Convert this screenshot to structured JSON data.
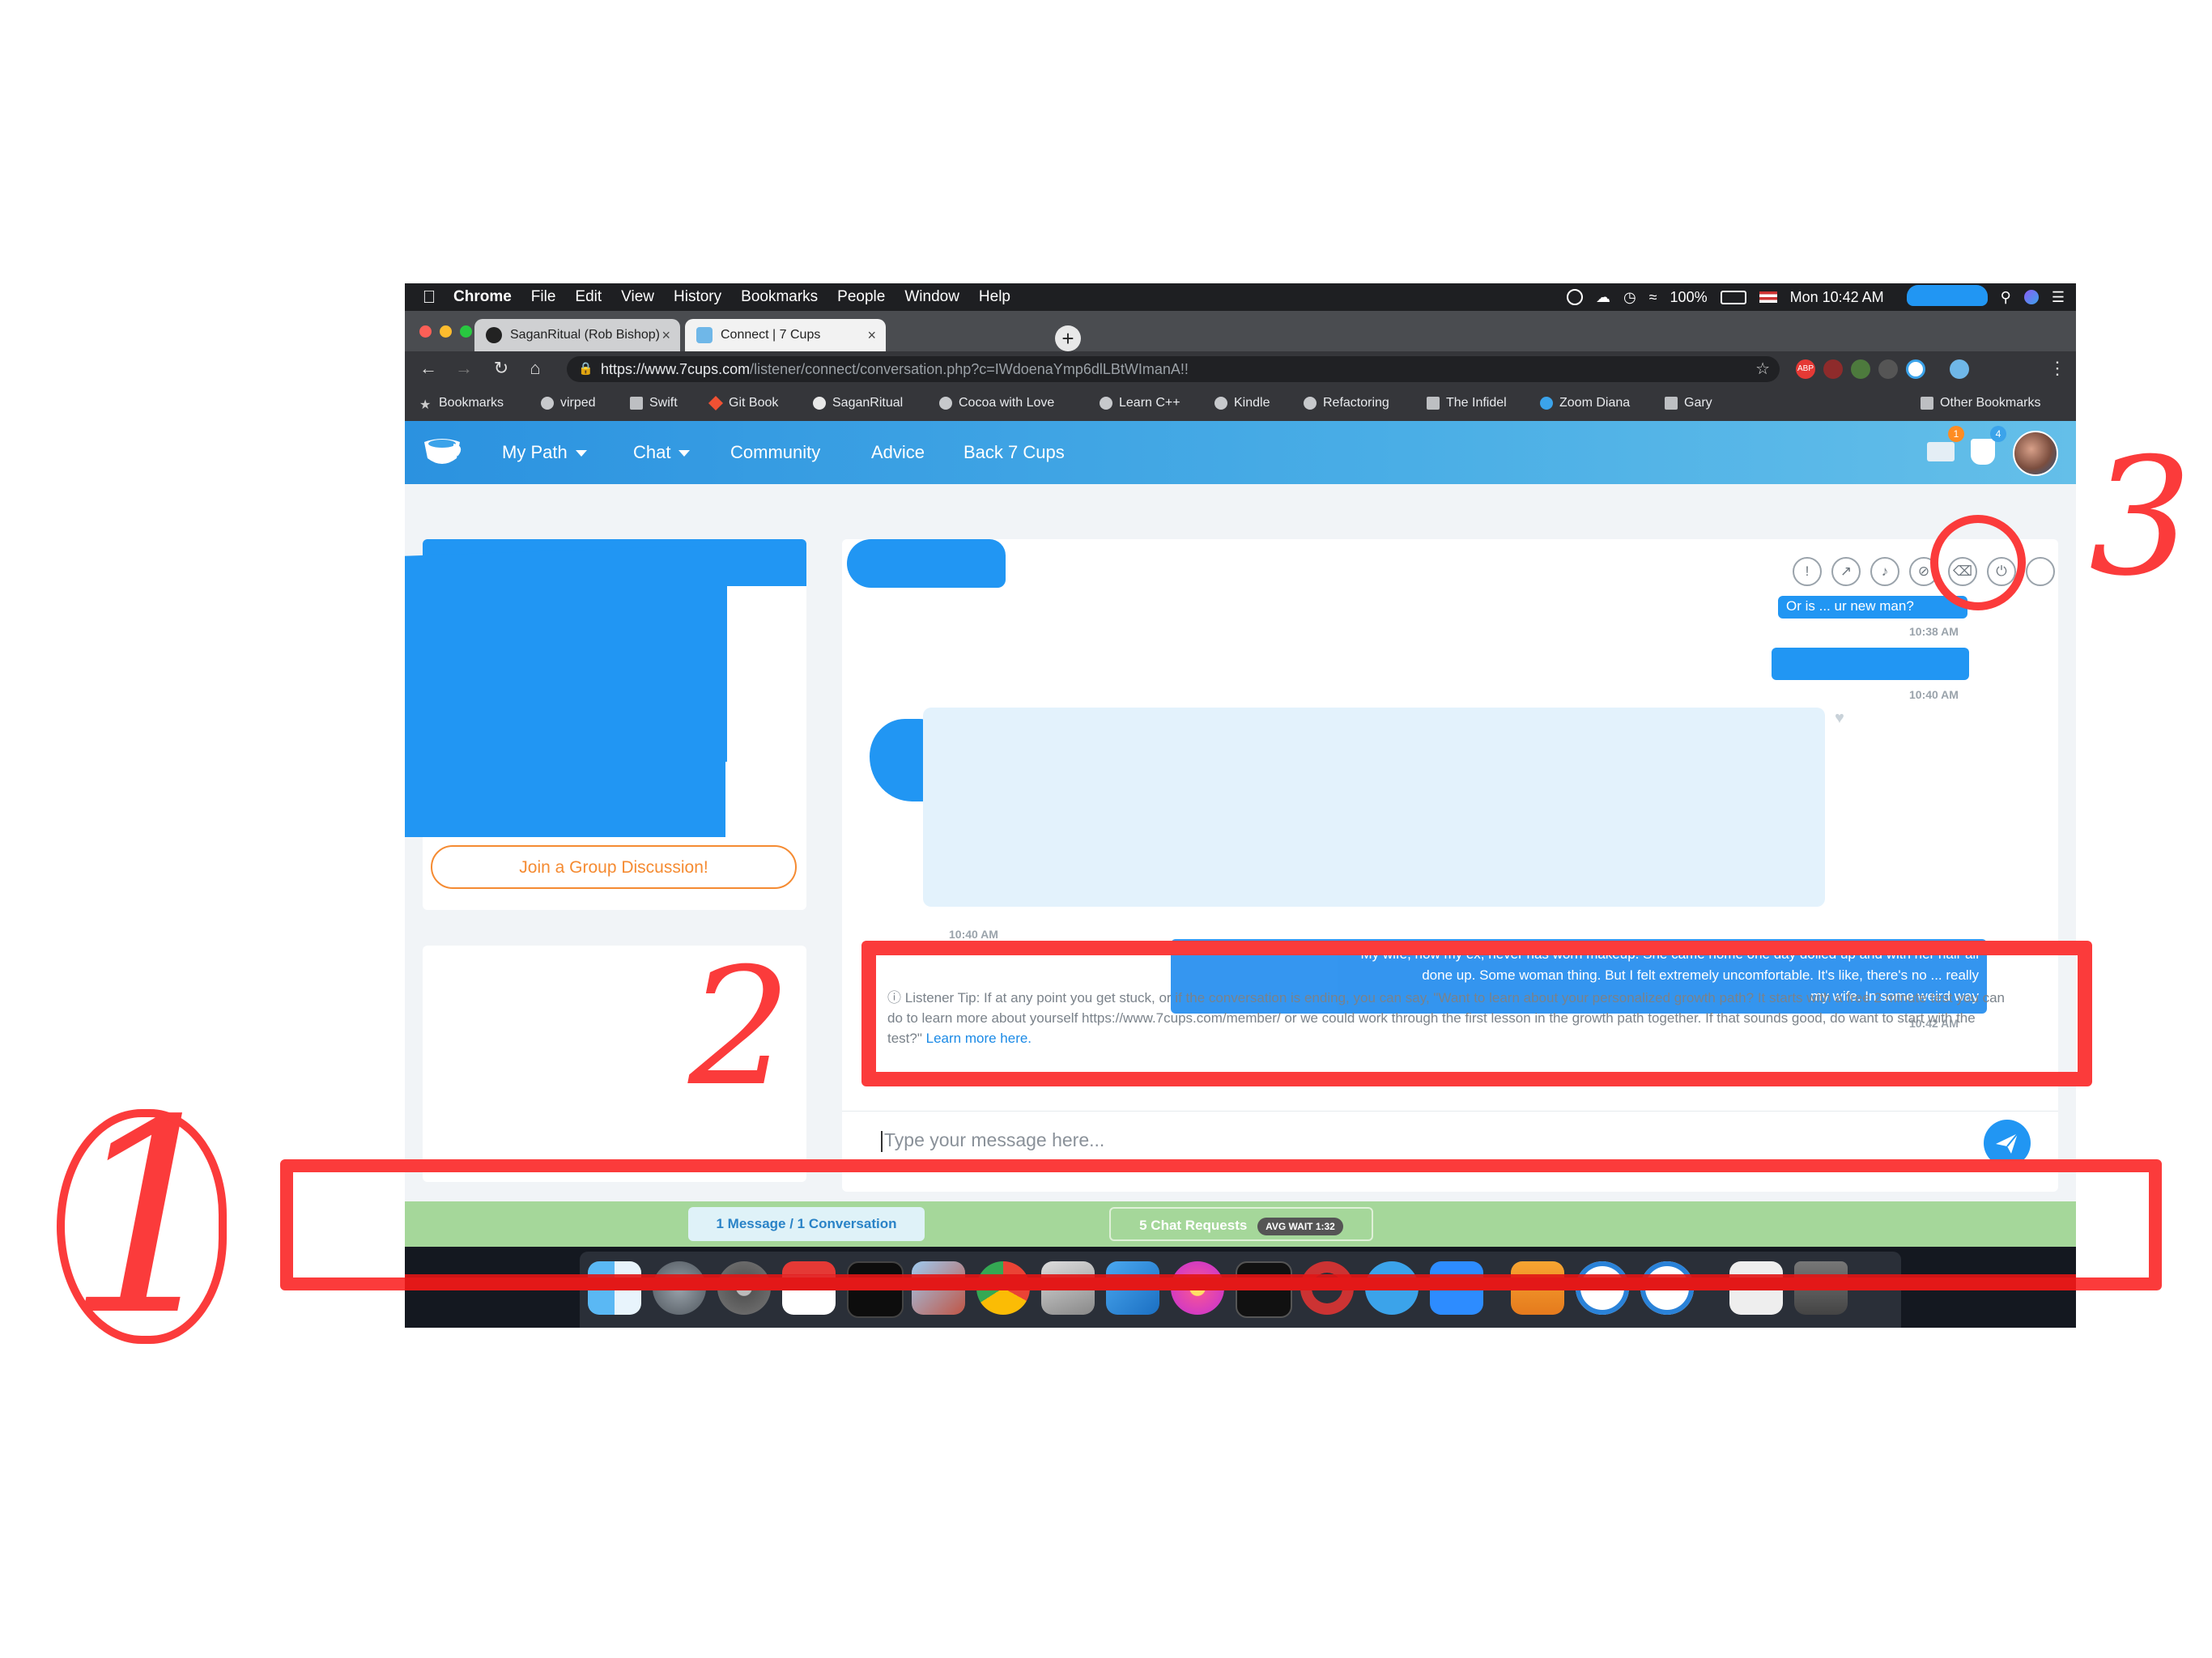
{
  "menubar": {
    "app": "Chrome",
    "items": [
      "File",
      "Edit",
      "View",
      "History",
      "Bookmarks",
      "People",
      "Window",
      "Help"
    ],
    "battery": "100%",
    "clock": "Mon 10:42 AM"
  },
  "tabs": [
    {
      "title": "SaganRitual (Rob Bishop)"
    },
    {
      "title": "Connect | 7 Cups"
    }
  ],
  "address_bar": {
    "url_host": "https://www.7cups.com",
    "url_path": "/listener/connect/conversation.php?c=IWdoenaYmp6dlLBtWImanA!!"
  },
  "bookmarks": [
    "Bookmarks",
    "virped",
    "Swift",
    "Git Book",
    "SaganRitual",
    "Cocoa with Love",
    "Learn C++",
    "Kindle",
    "Refactoring",
    "The Infidel",
    "Zoom Diana",
    "Gary",
    "Other Bookmarks"
  ],
  "site_nav": {
    "items": [
      "My Path",
      "Chat",
      "Community",
      "Advice",
      "Back 7 Cups"
    ],
    "notif_mail_count": "1",
    "notif_cup_count": "4"
  },
  "left_panel": {
    "join_button": "Join a Group Discussion!"
  },
  "chat": {
    "outgoing_1": "Or is ... ur new man?",
    "time_1": "10:38 AM",
    "time_2": "10:40 AM",
    "time_3": "10:40 AM",
    "outgoing_3_line1": "My wife, now my ex, never has worn makeup. She came home one day dolled up and with her hair all",
    "outgoing_3_line2": "done up. Some woman thing. But I felt extremely uncomfortable. It's like, there's no ... really",
    "outgoing_3_line3": "my wife. In some weird way",
    "time_4": "10:42 AM",
    "tip_icon": "info-icon",
    "tip_text": "Listener Tip: If at any point you get stuck, or if the conversation is ending, you can say, \"Want to learn about your personalized growth path? It starts with a free 2 minute test you can do to learn more about yourself https://www.7cups.com/member/ or we could work through the first lesson in the growth path together. If that sounds good, do want to start with the test?\"",
    "tip_link": "Learn more here.",
    "composer_placeholder": "Type your message here..."
  },
  "statusbar": {
    "messages": "1 Message / 1 Conversation",
    "requests": "5 Chat Requests",
    "wait": "AVG WAIT 1:32"
  },
  "annotations": {
    "n1": "1",
    "n2": "2",
    "n3": "3",
    "color": "#fb3b3b"
  },
  "colors": {
    "brand_blue": "#2196f3",
    "status_green": "#a5d79a",
    "orange": "#f58b32"
  }
}
